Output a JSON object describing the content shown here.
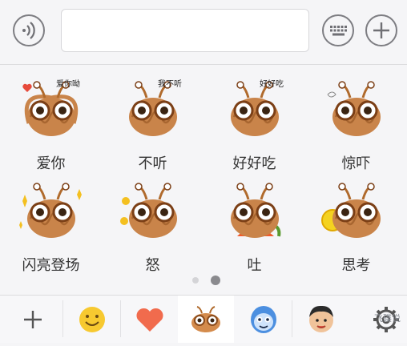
{
  "composer": {
    "voice_icon": "voice-wave-icon",
    "keyboard_icon": "keyboard-icon",
    "add_icon": "plus-icon",
    "text_value": ""
  },
  "stickers": [
    {
      "label": "爱你",
      "caption": "爱你呦"
    },
    {
      "label": "不听",
      "caption": "我不听"
    },
    {
      "label": "好好吃",
      "caption": "好好吃"
    },
    {
      "label": "惊吓",
      "caption": ""
    },
    {
      "label": "闪亮登场",
      "caption": ""
    },
    {
      "label": "怒",
      "caption": ""
    },
    {
      "label": "吐",
      "caption": ""
    },
    {
      "label": "思考",
      "caption": ""
    }
  ],
  "pager": {
    "pages": 2,
    "current": 2
  },
  "tabs": [
    {
      "icon": "plus-icon"
    },
    {
      "icon": "smiley-emoji-icon"
    },
    {
      "icon": "heart-icon"
    },
    {
      "icon": "noodle-monster-sticker-icon",
      "selected": true
    },
    {
      "icon": "blue-character-sticker-icon"
    },
    {
      "icon": "boy-face-sticker-icon"
    },
    {
      "icon": "settings-gear-icon"
    }
  ],
  "watermark": "飞碟说",
  "colors": {
    "accent_orange": "#e8a24a",
    "noodle_brown": "#c9844a",
    "heart_red": "#f16b4d"
  }
}
